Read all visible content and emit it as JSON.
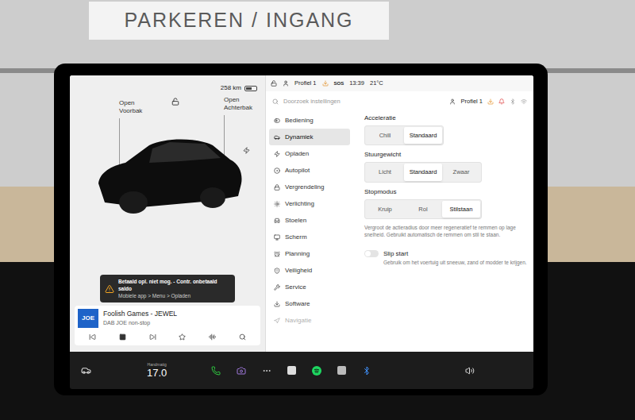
{
  "background": {
    "sign": "PARKEREN / INGANG"
  },
  "car_panel": {
    "range": "258 km",
    "battery_level": 0.6,
    "frunk_label": [
      "Open",
      "Voorbak"
    ],
    "trunk_label": [
      "Open",
      "Achterbak"
    ],
    "locked": false
  },
  "alert": {
    "title": "Betaald opl. niet mog. - Contr. onbetaald saldo",
    "subtitle": "Mobiele app > Menu > Opladen"
  },
  "media": {
    "logo": "JOE",
    "title": "Foolish Games - JEWEL",
    "source": "DAB JOE non-stop"
  },
  "status_bar": {
    "profile": "Profiel 1",
    "sos": "SOS",
    "time": "13:39",
    "temperature": "21°C"
  },
  "search": {
    "placeholder": "Doorzoek instellingen"
  },
  "profile": "Profiel 1",
  "sidebar": {
    "items": [
      {
        "label": "Bediening",
        "selected": false,
        "faded": false
      },
      {
        "label": "Dynamiek",
        "selected": true,
        "faded": false
      },
      {
        "label": "Opladen",
        "selected": false,
        "faded": false
      },
      {
        "label": "Autopilot",
        "selected": false,
        "faded": false
      },
      {
        "label": "Vergrendeling",
        "selected": false,
        "faded": false
      },
      {
        "label": "Verlichting",
        "selected": false,
        "faded": false
      },
      {
        "label": "Stoelen",
        "selected": false,
        "faded": false
      },
      {
        "label": "Scherm",
        "selected": false,
        "faded": false
      },
      {
        "label": "Planning",
        "selected": false,
        "faded": false
      },
      {
        "label": "Veiligheid",
        "selected": false,
        "faded": false
      },
      {
        "label": "Service",
        "selected": false,
        "faded": false
      },
      {
        "label": "Software",
        "selected": false,
        "faded": false
      },
      {
        "label": "Navigatie",
        "selected": false,
        "faded": true
      }
    ]
  },
  "settings": [
    {
      "title": "Acceleratie",
      "options": [
        {
          "label": "Chill",
          "selected": false
        },
        {
          "label": "Standaard",
          "selected": true
        }
      ]
    },
    {
      "title": "Stuurgewicht",
      "options": [
        {
          "label": "Licht",
          "selected": false
        },
        {
          "label": "Standaard",
          "selected": true
        },
        {
          "label": "Zwaar",
          "selected": false
        }
      ]
    },
    {
      "title": "Stopmodus",
      "options": [
        {
          "label": "Kruip",
          "selected": false
        },
        {
          "label": "Rol",
          "selected": false
        },
        {
          "label": "Stilstaan",
          "selected": true
        }
      ]
    }
  ],
  "stop_mode_note": "Vergroot de actieradius door meer regeneratief te remmen op lage snelheid. Gebruikt automatisch de remmen om stil te staan.",
  "slip_start": {
    "label": "Slip start",
    "on": false,
    "description": "Gebruik om het voertuig uit sneeuw, zand of modder te krijgen."
  },
  "dock": {
    "climate_label": "Handmatig",
    "temperature": "17.0"
  }
}
